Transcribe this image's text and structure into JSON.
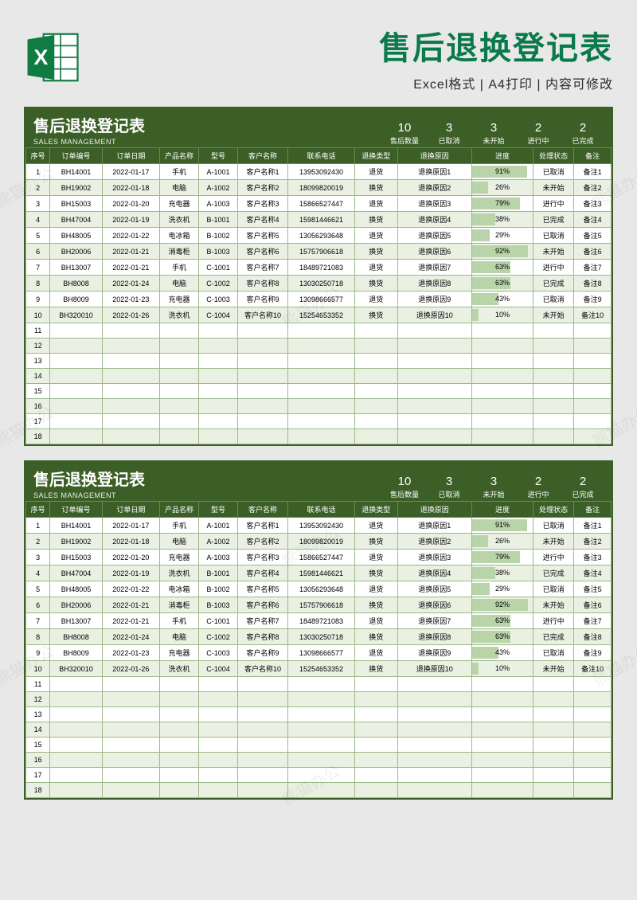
{
  "header": {
    "title": "售后退换登记表",
    "subtitle": "Excel格式 | A4打印 | 内容可修改"
  },
  "watermark": "熊猫办公",
  "sheet": {
    "title": "售后退换登记表",
    "english": "SALES MANAGEMENT",
    "stats": [
      {
        "num": "10",
        "label": "售后数量"
      },
      {
        "num": "3",
        "label": "已取消"
      },
      {
        "num": "3",
        "label": "未开始"
      },
      {
        "num": "2",
        "label": "进行中"
      },
      {
        "num": "2",
        "label": "已完成"
      }
    ],
    "columns": [
      "序号",
      "订单编号",
      "订单日期",
      "产品名称",
      "型号",
      "客户名称",
      "联系电话",
      "退换类型",
      "退换原因",
      "进度",
      "处理状态",
      "备注"
    ],
    "rows": [
      {
        "seq": "1",
        "order": "BH14001",
        "date": "2022-01-17",
        "prod": "手机",
        "model": "A-1001",
        "cust": "客户名称1",
        "phone": "13953092430",
        "type": "退货",
        "reason": "退换原因1",
        "prog": 91,
        "status": "已取消",
        "note": "备注1"
      },
      {
        "seq": "2",
        "order": "BH19002",
        "date": "2022-01-18",
        "prod": "电脑",
        "model": "A-1002",
        "cust": "客户名称2",
        "phone": "18099820019",
        "type": "换货",
        "reason": "退换原因2",
        "prog": 26,
        "status": "未开始",
        "note": "备注2"
      },
      {
        "seq": "3",
        "order": "BH15003",
        "date": "2022-01-20",
        "prod": "充电器",
        "model": "A-1003",
        "cust": "客户名称3",
        "phone": "15866527447",
        "type": "退货",
        "reason": "退换原因3",
        "prog": 79,
        "status": "进行中",
        "note": "备注3"
      },
      {
        "seq": "4",
        "order": "BH47004",
        "date": "2022-01-19",
        "prod": "洗衣机",
        "model": "B-1001",
        "cust": "客户名称4",
        "phone": "15981446621",
        "type": "换货",
        "reason": "退换原因4",
        "prog": 38,
        "status": "已完成",
        "note": "备注4"
      },
      {
        "seq": "5",
        "order": "BH48005",
        "date": "2022-01-22",
        "prod": "电冰箱",
        "model": "B-1002",
        "cust": "客户名称5",
        "phone": "13056293648",
        "type": "退货",
        "reason": "退换原因5",
        "prog": 29,
        "status": "已取消",
        "note": "备注5"
      },
      {
        "seq": "6",
        "order": "BH20006",
        "date": "2022-01-21",
        "prod": "消毒柜",
        "model": "B-1003",
        "cust": "客户名称6",
        "phone": "15757906618",
        "type": "换货",
        "reason": "退换原因6",
        "prog": 92,
        "status": "未开始",
        "note": "备注6"
      },
      {
        "seq": "7",
        "order": "BH13007",
        "date": "2022-01-21",
        "prod": "手机",
        "model": "C-1001",
        "cust": "客户名称7",
        "phone": "18489721083",
        "type": "退货",
        "reason": "退换原因7",
        "prog": 63,
        "status": "进行中",
        "note": "备注7"
      },
      {
        "seq": "8",
        "order": "BH8008",
        "date": "2022-01-24",
        "prod": "电脑",
        "model": "C-1002",
        "cust": "客户名称8",
        "phone": "13030250718",
        "type": "换货",
        "reason": "退换原因8",
        "prog": 63,
        "status": "已完成",
        "note": "备注8"
      },
      {
        "seq": "9",
        "order": "BH8009",
        "date": "2022-01-23",
        "prod": "充电器",
        "model": "C-1003",
        "cust": "客户名称9",
        "phone": "13098666577",
        "type": "退货",
        "reason": "退换原因9",
        "prog": 43,
        "status": "已取消",
        "note": "备注9"
      },
      {
        "seq": "10",
        "order": "BH320010",
        "date": "2022-01-26",
        "prod": "洗衣机",
        "model": "C-1004",
        "cust": "客户名称10",
        "phone": "15254653352",
        "type": "换货",
        "reason": "退换原因10",
        "prog": 10,
        "status": "未开始",
        "note": "备注10"
      }
    ],
    "empty_rows": [
      "11",
      "12",
      "13",
      "14",
      "15",
      "16",
      "17",
      "18"
    ]
  }
}
